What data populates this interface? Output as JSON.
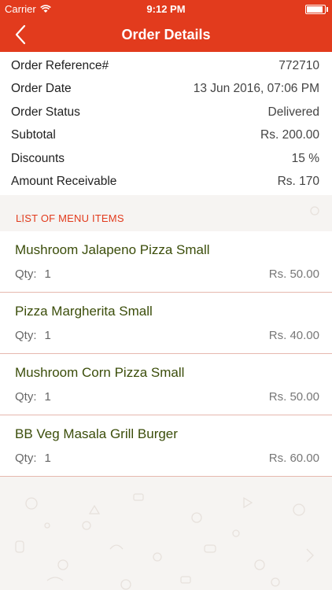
{
  "status_bar": {
    "carrier": "Carrier",
    "time": "9:12 PM",
    "battery_level": 1.0
  },
  "nav": {
    "title": "Order Details",
    "back_icon": "chevron-left-icon"
  },
  "summary": [
    {
      "label": "Order Reference#",
      "value": "772710"
    },
    {
      "label": "Order Date",
      "value": "13 Jun 2016, 07:06 PM"
    },
    {
      "label": "Order Status",
      "value": "Delivered"
    },
    {
      "label": "Subtotal",
      "value": "Rs. 200.00"
    },
    {
      "label": "Discounts",
      "value": "15 %"
    },
    {
      "label": "Amount Receivable",
      "value": "Rs. 170"
    }
  ],
  "menu_section": {
    "header": "LIST OF MENU ITEMS",
    "qty_label": "Qty:",
    "items": [
      {
        "name": "Mushroom Jalapeno Pizza Small",
        "qty": "1",
        "price": "Rs. 50.00"
      },
      {
        "name": "Pizza Margherita Small",
        "qty": "1",
        "price": "Rs. 40.00"
      },
      {
        "name": "Mushroom Corn Pizza Small",
        "qty": "1",
        "price": "Rs. 50.00"
      },
      {
        "name": "BB Veg Masala Grill Burger",
        "qty": "1",
        "price": "Rs. 60.00"
      }
    ]
  },
  "colors": {
    "brand": "#e23b1d",
    "item_name": "#3b4d0a",
    "divider": "#e6b8ae"
  }
}
